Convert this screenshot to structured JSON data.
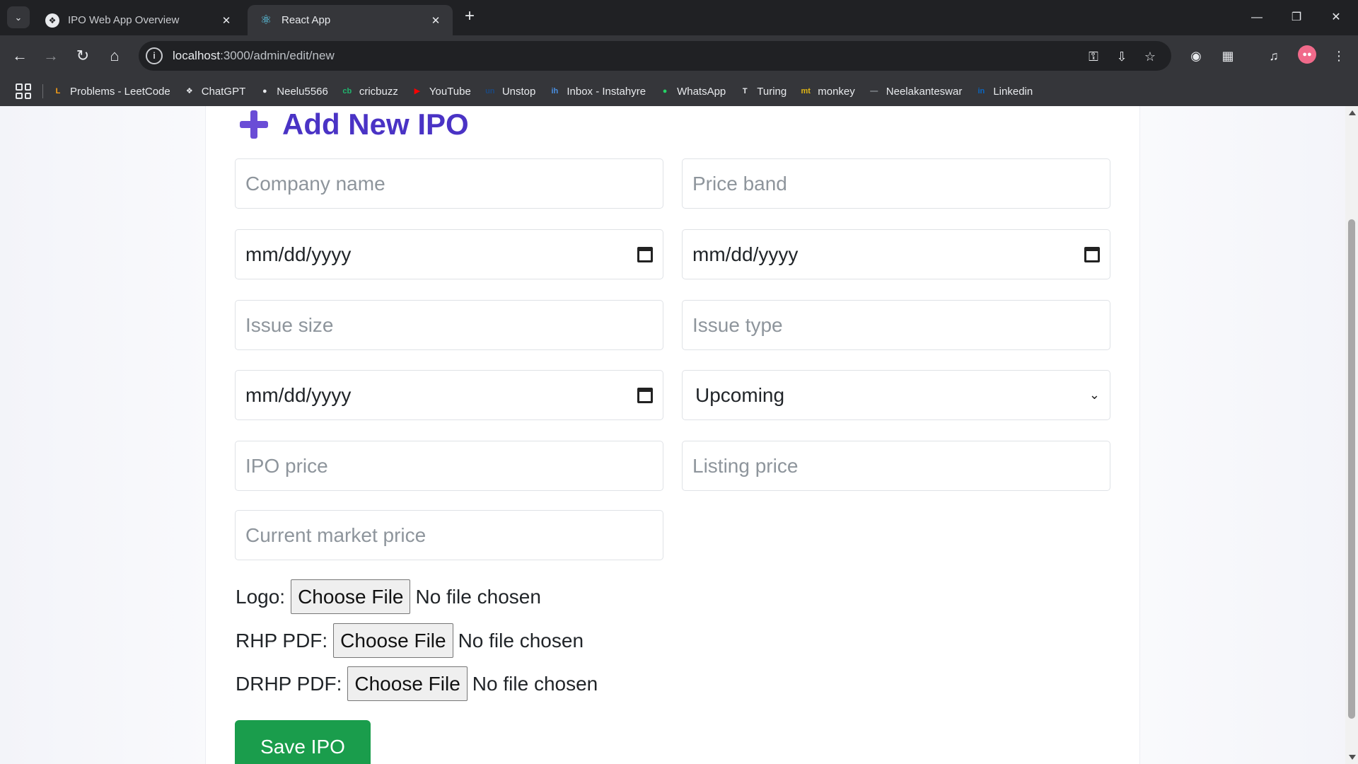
{
  "browser": {
    "tabs": [
      {
        "title": "IPO Web App Overview",
        "active": false,
        "icon": "openai-icon"
      },
      {
        "title": "React App",
        "active": true,
        "icon": "react-icon"
      }
    ],
    "url_host": "localhost",
    "url_path": ":3000/admin/edit/new",
    "bookmarks": [
      {
        "label": "Problems - LeetCode",
        "icon": "leetcode-icon",
        "color": "#ffa116"
      },
      {
        "label": "ChatGPT",
        "icon": "openai-icon",
        "color": "#e8eaed"
      },
      {
        "label": "Neelu5566",
        "icon": "github-icon",
        "color": "#e8eaed"
      },
      {
        "label": "cricbuzz",
        "icon": "cricbuzz-icon",
        "color": "#21b46e"
      },
      {
        "label": "YouTube",
        "icon": "youtube-icon",
        "color": "#ff0000"
      },
      {
        "label": "Unstop",
        "icon": "unstop-icon",
        "color": "#1c4980"
      },
      {
        "label": "Inbox - Instahyre",
        "icon": "instahyre-icon",
        "color": "#4a90e2"
      },
      {
        "label": "WhatsApp",
        "icon": "whatsapp-icon",
        "color": "#25d366"
      },
      {
        "label": "Turing",
        "icon": "turing-icon",
        "color": "#e8eaed"
      },
      {
        "label": "monkey",
        "icon": "monkeytype-icon",
        "color": "#e2b714"
      },
      {
        "label": "Neelakanteswar",
        "icon": "link-icon",
        "color": "#9aa0a6"
      },
      {
        "label": "Linkedin",
        "icon": "linkedin-icon",
        "color": "#0a66c2"
      }
    ]
  },
  "page": {
    "title": "Add New IPO",
    "title_color": "#4a33c5",
    "fields": {
      "company_name_placeholder": "Company name",
      "price_band_placeholder": "Price band",
      "open_date": "mm/dd/yyyy",
      "close_date": "mm/dd/yyyy",
      "issue_size_placeholder": "Issue size",
      "issue_type_placeholder": "Issue type",
      "listing_date": "mm/dd/yyyy",
      "status_selected": "Upcoming",
      "ipo_price_placeholder": "IPO price",
      "listing_price_placeholder": "Listing price",
      "current_market_price_placeholder": "Current market price"
    },
    "files": [
      {
        "label": "Logo:",
        "button": "Choose File",
        "status": "No file chosen"
      },
      {
        "label": "RHP PDF:",
        "button": "Choose File",
        "status": "No file chosen"
      },
      {
        "label": "DRHP PDF:",
        "button": "Choose File",
        "status": "No file chosen"
      }
    ],
    "save_label": "Save IPO",
    "save_color": "#1a9d4c"
  }
}
